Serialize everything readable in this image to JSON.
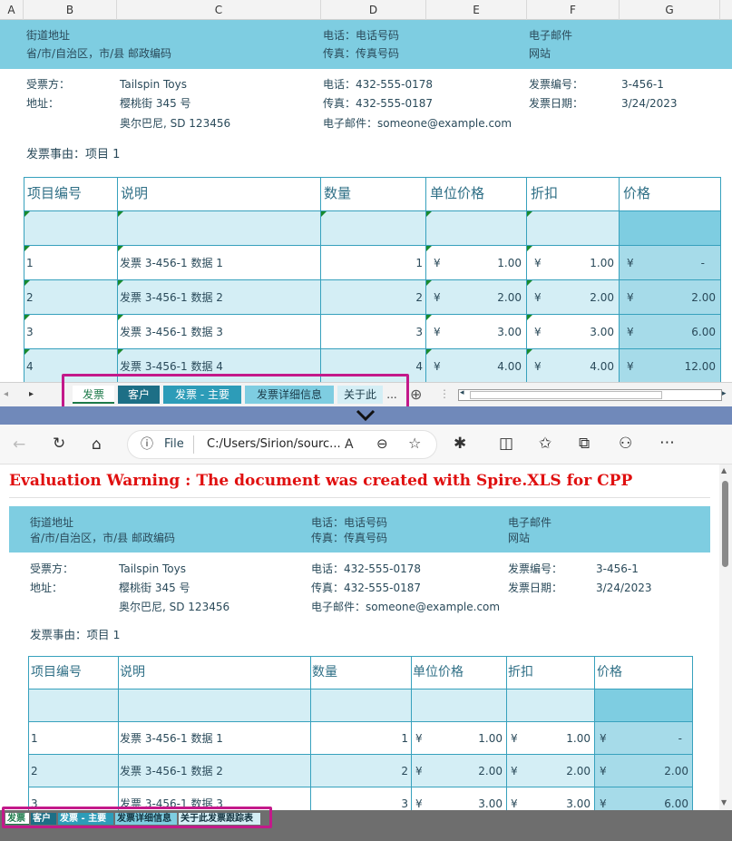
{
  "excel": {
    "columns": [
      "A",
      "B",
      "C",
      "D",
      "E",
      "F",
      "G"
    ],
    "header": {
      "street": "街道地址",
      "province": "省/市/自治区，市/县  邮政编码",
      "phone": "电话：电话号码",
      "fax": "传真：传真号码",
      "email": "电子邮件",
      "website": "网站"
    },
    "billto": {
      "label": "受票方：",
      "name": "Tailspin Toys",
      "addr_label": "地址：",
      "addr1": "樱桃街 345 号",
      "addr2": "奥尔巴尼, SD 123456",
      "phone": "电话：432-555-0178",
      "fax": "传真：432-555-0187",
      "email": "电子邮件：someone@example.com",
      "inv_no_label": "发票编号：",
      "inv_no": "3-456-1",
      "inv_date_label": "发票日期：",
      "inv_date": "3/24/2023"
    },
    "reason": "发票事由：项目 1",
    "table": {
      "headers": [
        "项目编号",
        "说明",
        "数量",
        "单位价格",
        "折扣",
        "价格"
      ],
      "rows": [
        {
          "no": "1",
          "desc": "发票 3-456-1 数据 1",
          "qty": "1",
          "cur": "¥",
          "unit": "1.00",
          "disc": "1.00",
          "price": "-"
        },
        {
          "no": "2",
          "desc": "发票 3-456-1 数据 2",
          "qty": "2",
          "cur": "¥",
          "unit": "2.00",
          "disc": "2.00",
          "price": "2.00"
        },
        {
          "no": "3",
          "desc": "发票 3-456-1 数据 3",
          "qty": "3",
          "cur": "¥",
          "unit": "3.00",
          "disc": "3.00",
          "price": "6.00"
        },
        {
          "no": "4",
          "desc": "发票 3-456-1 数据 4",
          "qty": "4",
          "cur": "¥",
          "unit": "4.00",
          "disc": "4.00",
          "price": "12.00"
        }
      ]
    },
    "tabs": [
      "发票",
      "客户",
      "发票 - 主要",
      "发票详细信息",
      "关于此"
    ],
    "tabs_more": "...",
    "add_sheet": "⊕"
  },
  "browser": {
    "file_label": "File",
    "url": "C:/Users/Sirion/sourc...",
    "read_aloud": "A",
    "warning": "Evaluation Warning : The document was created with  Spire.XLS for CPP",
    "tabs": [
      "发票",
      "客户",
      "发票 - 主要",
      "发票详细信息",
      "关于此发票跟踪表"
    ]
  },
  "colors": {
    "band": "#7ecde1",
    "row_alt": "#d4eef5",
    "price_col": "#a6dbe9",
    "tab_active": "#1d6f86",
    "highlight": "#c3198a",
    "warning": "#e01010"
  }
}
